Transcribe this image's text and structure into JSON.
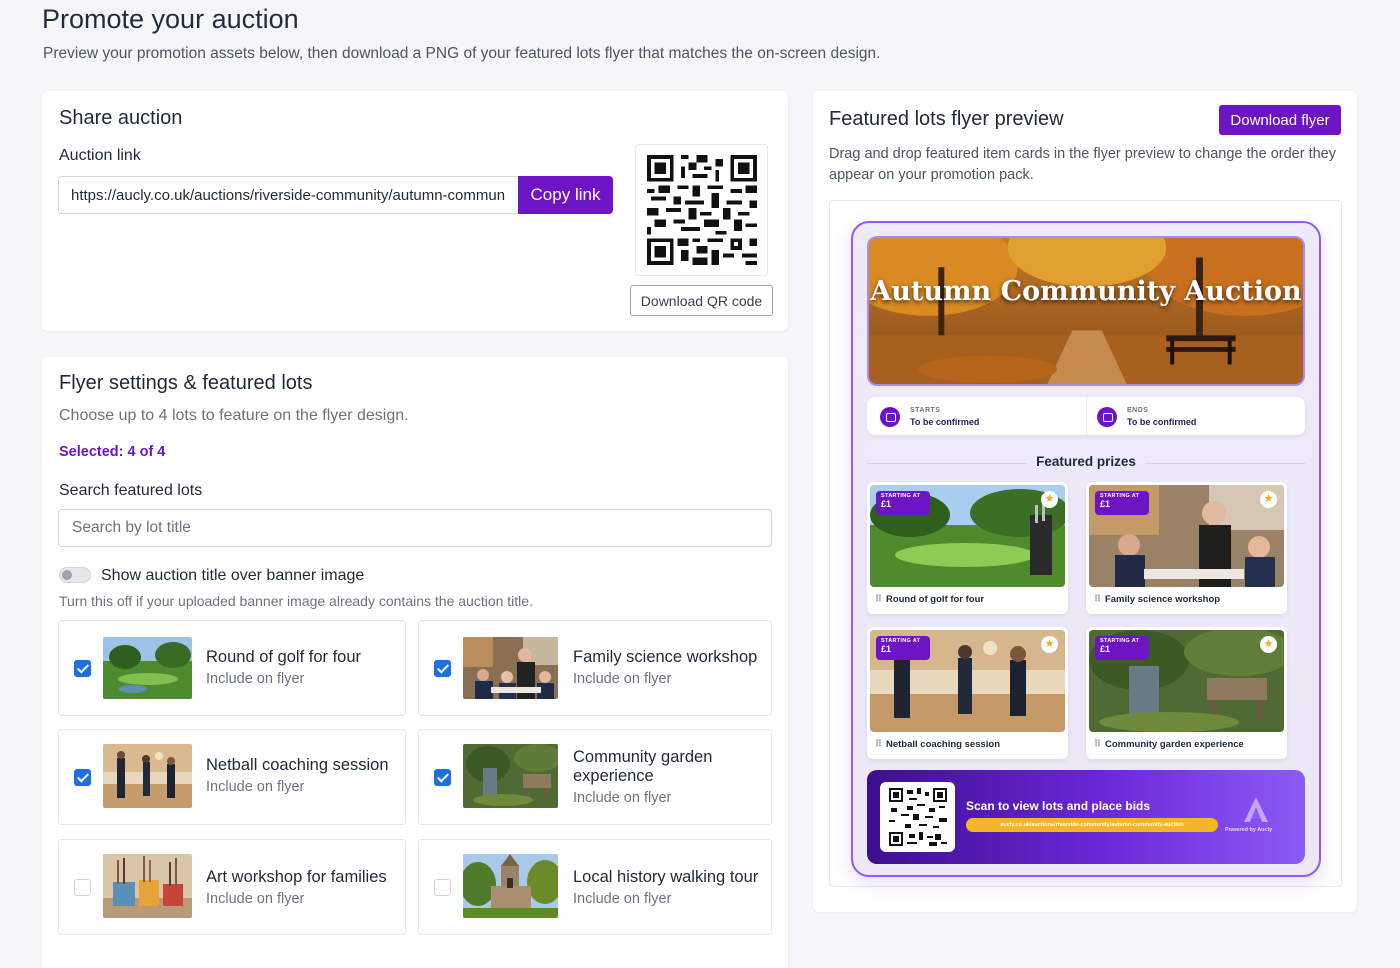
{
  "page": {
    "title": "Promote your auction",
    "subtitle": "Preview your promotion assets below, then download a PNG of your featured lots flyer that matches the on-screen design."
  },
  "share": {
    "title": "Share auction",
    "link_label": "Auction link",
    "link_value": "https://aucly.co.uk/auctions/riverside-community/autumn-communi",
    "copy_label": "Copy link",
    "qr_download_label": "Download QR code"
  },
  "settings": {
    "title": "Flyer settings & featured lots",
    "description": "Choose up to 4 lots to feature on the flyer design.",
    "selected": "Selected: 4 of 4",
    "search_label": "Search featured lots",
    "search_placeholder": "Search by lot title",
    "toggle_label": "Show auction title over banner image",
    "toggle_on": false,
    "toggle_help": "Turn this off if your uploaded banner image already contains the auction title.",
    "include_label": "Include on flyer",
    "lots": [
      {
        "title": "Round of golf for four",
        "checked": true
      },
      {
        "title": "Family science workshop",
        "checked": true
      },
      {
        "title": "Netball coaching session",
        "checked": true
      },
      {
        "title": "Community garden experience",
        "checked": true
      },
      {
        "title": "Art workshop for families",
        "checked": false
      },
      {
        "title": "Local history walking tour",
        "checked": false
      }
    ]
  },
  "preview": {
    "title": "Featured lots flyer preview",
    "download_label": "Download flyer",
    "description": "Drag and drop featured item cards in the flyer preview to change the order they appear on your promotion pack.",
    "flyer": {
      "banner_title": "Autumn Community Auction",
      "starts_label": "STARTS",
      "starts_value": "To be confirmed",
      "ends_label": "ENDS",
      "ends_value": "To be confirmed",
      "featured_heading": "Featured prizes",
      "badge_label": "STARTING AT",
      "badge_value": "£1",
      "prizes": [
        {
          "name": "Round of golf for four"
        },
        {
          "name": "Family science workshop"
        },
        {
          "name": "Netball coaching session"
        },
        {
          "name": "Community garden experience"
        }
      ],
      "scan_text": "Scan to view lots and place bids",
      "scan_url": "aucly.co.uk/auctions/riverside-community/autumn-community-auction",
      "powered_by": "Powered by Aucly"
    }
  },
  "colors": {
    "accent": "#6d14c4",
    "checkbox": "#1f6fe0",
    "flyer_border": "#8b5cf6"
  }
}
